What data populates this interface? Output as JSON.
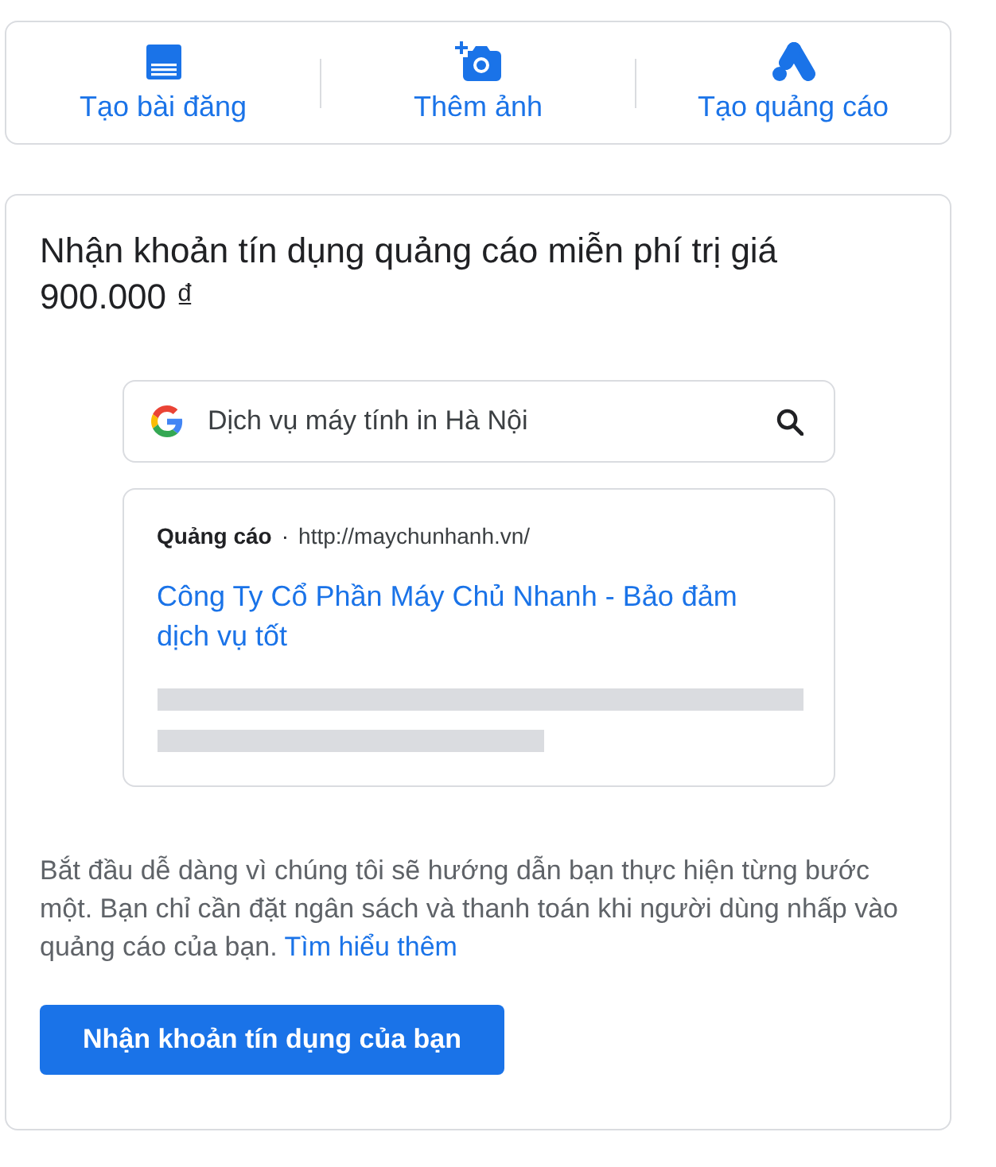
{
  "actions": [
    {
      "kind": "post",
      "label": "Tạo bài đăng"
    },
    {
      "kind": "photo",
      "label": "Thêm ảnh"
    },
    {
      "kind": "ads",
      "label": "Tạo quảng cáo"
    }
  ],
  "promo": {
    "title": "Nhận khoản tín dụng quảng cáo miễn phí trị giá 900.000 ₫",
    "search": {
      "value": "Dịch vụ máy tính in Hà Nội"
    },
    "ad": {
      "label": "Quảng cáo",
      "separator": "·",
      "url": "http://maychunhanh.vn/",
      "headline": "Công Ty Cổ Phần Máy Chủ Nhanh - Bảo đảm dịch vụ tốt"
    },
    "description": {
      "text": "Bắt đầu dễ dàng vì chúng tôi sẽ hướng dẫn bạn thực hiện từng bước một. Bạn chỉ cần đặt ngân sách và thanh toán khi người dùng nhấp vào quảng cáo của bạn.",
      "link": "Tìm hiểu thêm"
    },
    "button": "Nhận khoản tín dụng của bạn"
  }
}
